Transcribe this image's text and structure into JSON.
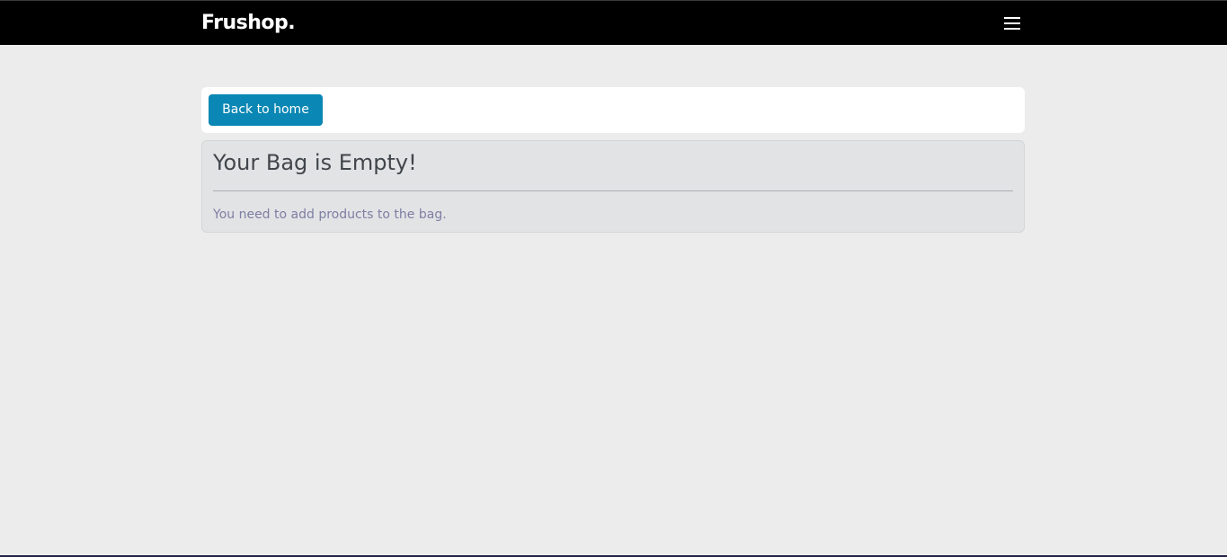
{
  "navbar": {
    "brand": "Frushop.",
    "menu_icon": "hamburger-menu-icon"
  },
  "toolbar": {
    "back_label": "Back to home"
  },
  "alert": {
    "title": "Your Bag is Empty!",
    "message": "You need to add products to the bag."
  },
  "colors": {
    "navbar_bg": "#000000",
    "page_bg": "#ececec",
    "button_bg": "#0a87b4",
    "alert_bg": "#e2e3e5"
  }
}
